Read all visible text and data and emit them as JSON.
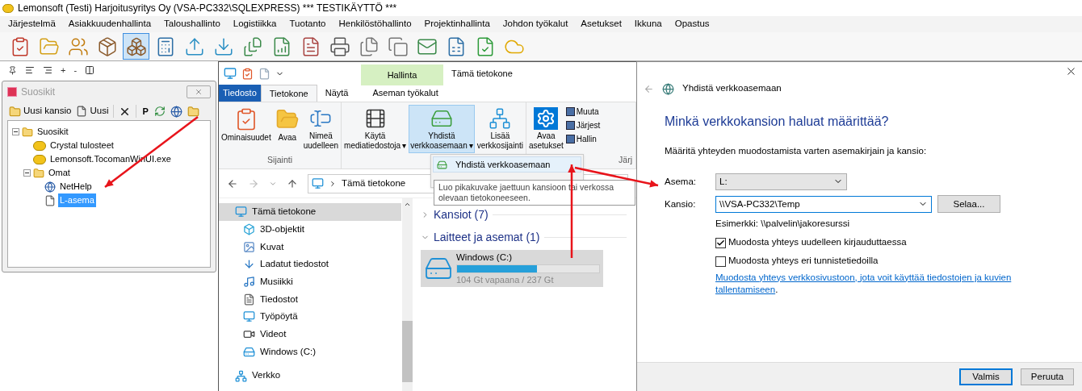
{
  "window": {
    "title": "Lemonsoft (Testi) Harjoitusyritys Oy (VSA-PC332\\SQLEXPRESS) *** TESTIKÄYTTÖ ***"
  },
  "menu": [
    "Järjestelmä",
    "Asiakkuudenhallinta",
    "Taloushallinto",
    "Logistiikka",
    "Tuotanto",
    "Henkilöstöhallinto",
    "Projektinhallinta",
    "Johdon työkalut",
    "Asetukset",
    "Ikkuna",
    "Opastus"
  ],
  "toolbar": [
    {
      "selected": false
    },
    {
      "selected": false
    },
    {
      "selected": false
    },
    {
      "selected": false
    },
    {
      "selected": true
    },
    {
      "selected": false
    },
    {
      "selected": false
    },
    {
      "selected": false
    },
    {
      "selected": false
    },
    {
      "selected": false
    },
    {
      "selected": false
    },
    {
      "selected": false
    },
    {
      "selected": false
    },
    {
      "selected": false
    },
    {
      "selected": false
    },
    {
      "selected": false
    },
    {
      "selected": false
    },
    {
      "selected": false
    }
  ],
  "small_toolbar": {
    "plus": "+",
    "minus": "-"
  },
  "favorites": {
    "title": "Suosikit",
    "buttons": [
      {
        "kind": "folder",
        "label": "Uusi kansio"
      },
      {
        "kind": "page",
        "label": "Uusi"
      },
      {
        "kind": "delete"
      },
      {
        "kind": "text",
        "label": "P"
      },
      {
        "kind": "refresh"
      },
      {
        "kind": "globe"
      },
      {
        "kind": "folder"
      }
    ],
    "tree": [
      {
        "label": "Suosikit",
        "kind": "folder",
        "expanded": true,
        "selected": false,
        "children": [
          {
            "label": "Crystal tulosteet",
            "kind": "lemon",
            "selected": false
          },
          {
            "label": "Lemonsoft.TocomanWinUI.exe",
            "kind": "lemon",
            "selected": false
          },
          {
            "label": "Omat",
            "kind": "folder",
            "expanded": true,
            "selected": false,
            "children": [
              {
                "label": "NetHelp",
                "kind": "globe",
                "selected": false
              },
              {
                "label": "L-asema",
                "kind": "page",
                "selected": true
              }
            ]
          }
        ]
      }
    ]
  },
  "explorer": {
    "context_header": "Hallinta",
    "title": "Tämä tietokone",
    "tabs": [
      {
        "label": "Tiedosto",
        "kind": "file",
        "selected": false
      },
      {
        "label": "Tietokone",
        "kind": "tab",
        "selected": true
      },
      {
        "label": "Näytä",
        "kind": "tab",
        "selected": false
      },
      {
        "label": "Aseman työkalut",
        "kind": "context",
        "selected": false
      }
    ],
    "groups": [
      {
        "label": "Sijainti",
        "buttons": [
          {
            "kind": "properties",
            "lines": [
              "Ominaisuudet"
            ],
            "selected": false
          },
          {
            "kind": "open",
            "lines": [
              "Avaa"
            ],
            "selected": false
          },
          {
            "kind": "rename",
            "lines": [
              "Nimeä",
              "uudelleen"
            ],
            "selected": false
          }
        ]
      },
      {
        "buttons": [
          {
            "kind": "media",
            "lines": [
              "Käytä",
              "mediatiedostoja"
            ],
            "caret": "▾",
            "selected": false
          },
          {
            "kind": "drive",
            "lines": [
              "Yhdistä",
              "verkkoasemaan"
            ],
            "caret": "▾",
            "selected": true
          },
          {
            "kind": "network",
            "lines": [
              "Lisää",
              "verkkosijainti"
            ],
            "selected": false
          }
        ]
      },
      {
        "label": "Järj",
        "buttons": [
          {
            "kind": "settings",
            "lines": [
              "Avaa",
              "asetukset"
            ],
            "selected": false
          }
        ],
        "small_buttons": [
          "Muuta",
          "Järjest",
          "Hallin"
        ]
      }
    ],
    "dropdown": [
      {
        "label": "Yhdistä verkkoasemaan",
        "selected": true
      }
    ],
    "tooltip": "Luo pikakuvake jaettuun kansioon tai verkossa olevaan tietokoneeseen.",
    "address": "Tämä tietokone",
    "nav": [
      {
        "label": "Tämä tietokone",
        "kind": "pc",
        "selected": true
      },
      {
        "label": "3D-objektit",
        "kind": "cube",
        "selected": false
      },
      {
        "label": "Kuvat",
        "kind": "pictures",
        "selected": false
      },
      {
        "label": "Ladatut tiedostot",
        "kind": "downloads",
        "selected": false
      },
      {
        "label": "Musiikki",
        "kind": "music",
        "selected": false
      },
      {
        "label": "Tiedostot",
        "kind": "documents",
        "selected": false
      },
      {
        "label": "Työpöytä",
        "kind": "desktop",
        "selected": false
      },
      {
        "label": "Videot",
        "kind": "videos",
        "selected": false
      },
      {
        "label": "Windows (C:)",
        "kind": "disk",
        "selected": false
      },
      {
        "label": "Verkko",
        "kind": "network",
        "selected": false
      }
    ],
    "sections": [
      {
        "label": "Kansiot (7)",
        "expanded": false
      },
      {
        "label": "Laitteet ja asemat (1)",
        "expanded": true
      }
    ],
    "drive": {
      "name": "Windows (C:)",
      "level": 0.56,
      "reading": "104 Gt vapaana / 237 Gt",
      "selected": true
    }
  },
  "dialog": {
    "title": "Yhdistä verkkoasemaan",
    "heading": "Minkä verkkokansion haluat määrittää?",
    "intro": "Määritä yhteyden muodostamista varten asemakirjain ja kansio:",
    "drive_label": "Asema:",
    "drive_value": "L:",
    "folder_label": "Kansio:",
    "folder_value": "\\\\VSA-PC332\\Temp",
    "browse": "Selaa...",
    "example": "Esimerkki: \\\\palvelin\\jakoresurssi",
    "checkboxes": [
      {
        "label": "Muodosta yhteys uudelleen kirjauduttaessa",
        "checked": true
      },
      {
        "label": "Muodosta yhteys eri tunnistetiedoilla",
        "checked": false
      }
    ],
    "link": "Muodosta yhteys verkkosivustoon, jota voit käyttää tiedostojen ja kuvien tallentamiseen",
    "link_end": ".",
    "buttons": [
      {
        "label": "Valmis",
        "kind": "default"
      },
      {
        "label": "Peruuta",
        "kind": "normal"
      }
    ]
  }
}
